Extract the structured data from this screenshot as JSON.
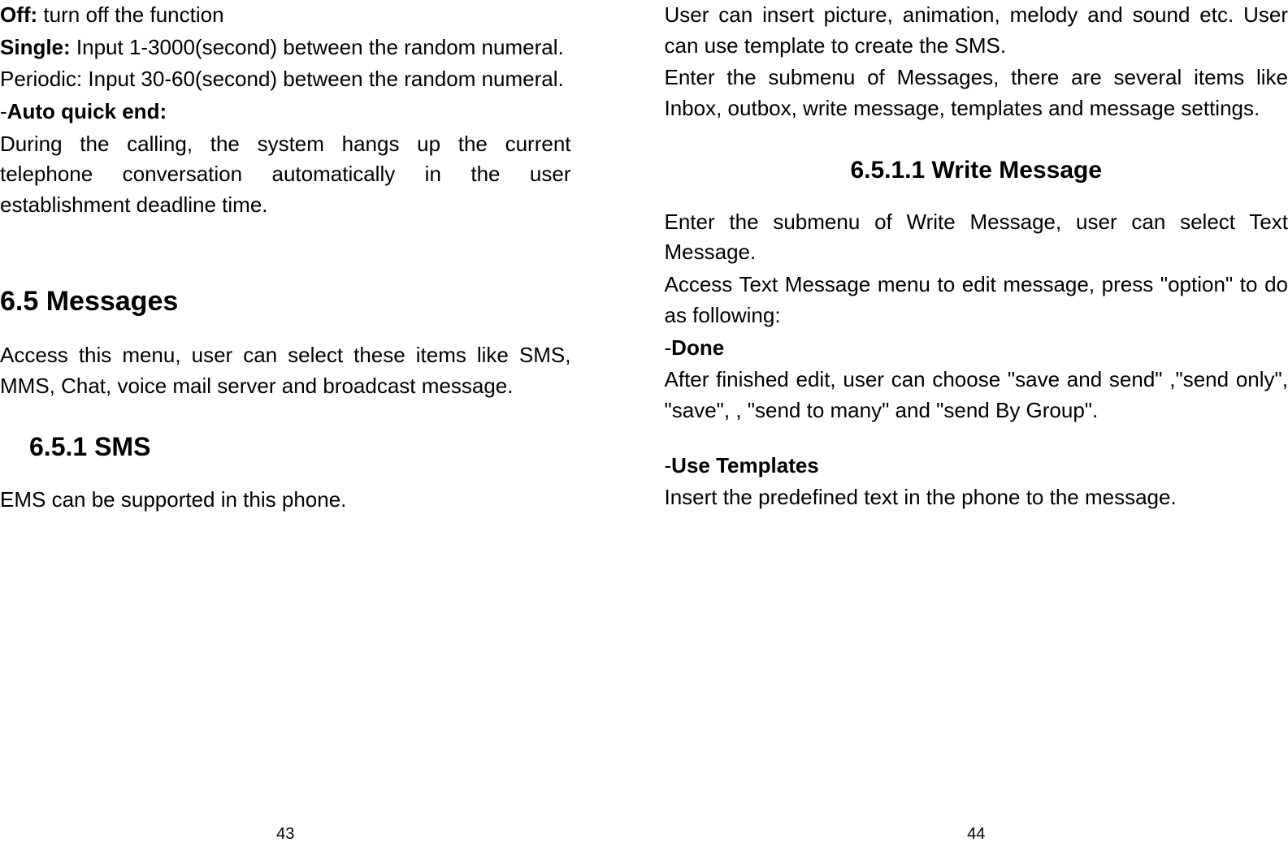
{
  "left": {
    "off_label": "Off:",
    "off_text": " turn off the function",
    "single_label": "Single:",
    "single_text": " Input 1-3000(second) between the random numeral.",
    "periodic_text": "Periodic: Input 30-60(second) between the random numeral.",
    "autoquick_dash": "-",
    "autoquick_label": "Auto quick end:",
    "autoquick_text": "During the calling, the system hangs up the current telephone conversation automatically in the user establishment deadline time.",
    "h65": "6.5 Messages",
    "h65_text": "Access this menu, user can select these items like SMS, MMS, Chat, voice mail server and broadcast message.",
    "h651": "6.5.1 SMS",
    "ems_text": "EMS can be supported in this phone.",
    "page_num": "43"
  },
  "right": {
    "intro1": "User can insert picture, animation, melody and sound etc. User can use template to create the SMS.",
    "intro2": "Enter the submenu of Messages, there are several items like Inbox, outbox, write message, templates and message settings.",
    "h6511": "6.5.1.1 Write Message",
    "writemsg1": "Enter the submenu of Write Message, user can select Text Message.",
    "writemsg2": "Access Text Message menu to edit message, press \"option\" to do as following:",
    "done_dash": "-",
    "done_label": "Done",
    "done_text": "After finished edit, user can choose \"save and send\" ,\"send only\", \"save\", , \"send to many\" and \"send By Group\".",
    "templates_dash": "-",
    "templates_label": "Use Templates",
    "templates_text": "Insert the predefined text in the phone to the message.",
    "page_num": "44"
  }
}
